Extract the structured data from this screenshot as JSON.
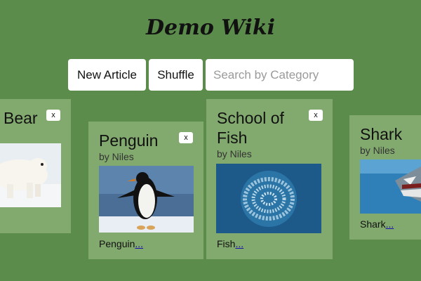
{
  "app": {
    "title": "Demo Wiki"
  },
  "toolbar": {
    "new_article_label": "New Article",
    "shuffle_label": "Shuffle",
    "search_placeholder": "Search by Category",
    "search_value": ""
  },
  "cards": [
    {
      "title": "Bear",
      "author": "",
      "excerpt": "",
      "more": "",
      "close": "x",
      "image": "polar-bear-photo"
    },
    {
      "title": "Penguin",
      "author": "by Niles",
      "excerpt": "Penguin",
      "more": "...",
      "close": "x",
      "image": "penguin-photo"
    },
    {
      "title": "School of Fish",
      "author": "by Niles",
      "excerpt": "Fish",
      "more": "...",
      "close": "x",
      "image": "fish-school-photo"
    },
    {
      "title": "Shark",
      "author": "by Niles",
      "excerpt": "Shark",
      "more": "...",
      "close": "",
      "image": "shark-photo"
    }
  ],
  "colors": {
    "background": "#5b8c4b",
    "card": "#82a96e",
    "link": "#1a0dab"
  }
}
